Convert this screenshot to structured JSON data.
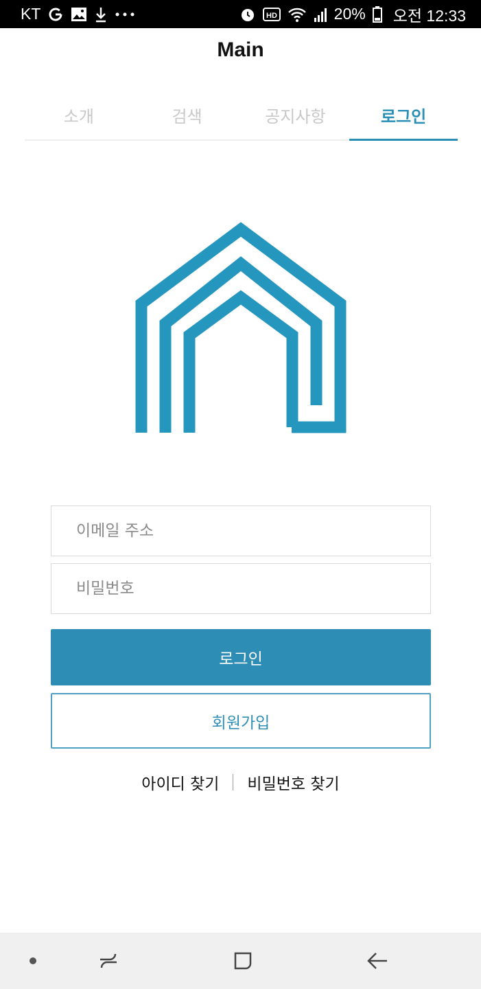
{
  "status_bar": {
    "carrier": "KT",
    "icons_left": [
      "g-icon",
      "gallery-icon",
      "download-icon",
      "more-icon"
    ],
    "icons_right": [
      "alarm-icon",
      "hd-icon",
      "wifi-icon",
      "signal-icon",
      "battery-icon"
    ],
    "battery": "20%",
    "time": "오전 12:33"
  },
  "header": {
    "title": "Main"
  },
  "tabs": [
    {
      "label": "소개",
      "active": false
    },
    {
      "label": "검색",
      "active": false
    },
    {
      "label": "공지사항",
      "active": false
    },
    {
      "label": "로그인",
      "active": true
    }
  ],
  "colors": {
    "accent": "#2b8fb5",
    "logo": "#2596be",
    "tab_inactive": "#c8c8c8"
  },
  "logo": {
    "icon": "house-logo-icon"
  },
  "form": {
    "email_placeholder": "이메일 주소",
    "email_value": "",
    "password_placeholder": "비밀번호",
    "password_value": "",
    "login_button": "로그인",
    "signup_button": "회원가입"
  },
  "links": {
    "find_id": "아이디 찾기",
    "find_password": "비밀번호 찾기"
  },
  "nav_bar": {
    "buttons": [
      "dot-icon",
      "recent-apps-icon",
      "home-icon",
      "back-icon"
    ]
  }
}
